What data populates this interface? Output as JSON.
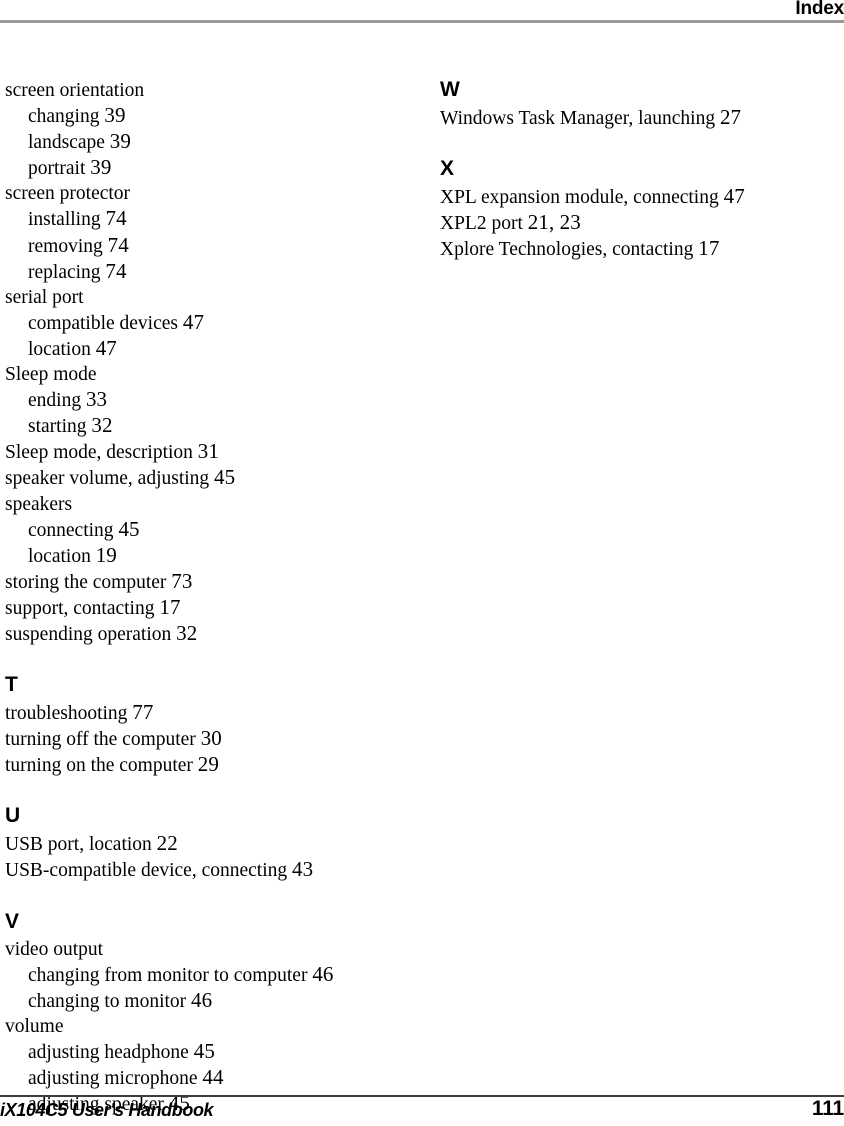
{
  "header": {
    "title": "Index",
    "rule_color": "#9a9a9a"
  },
  "footer": {
    "document_title": "iX104C5 User's Handbook",
    "page_number": "111",
    "rule_color": "#3c3c3c"
  },
  "columns": {
    "left": [
      {
        "letter": null,
        "entries": [
          {
            "text": "screen orientation",
            "page": "",
            "level": 0
          },
          {
            "text": "changing",
            "page": "39",
            "level": 1
          },
          {
            "text": "landscape",
            "page": "39",
            "level": 1
          },
          {
            "text": "portrait",
            "page": "39",
            "level": 1
          },
          {
            "text": "screen protector",
            "page": "",
            "level": 0
          },
          {
            "text": "installing",
            "page": "74",
            "level": 1
          },
          {
            "text": "removing",
            "page": "74",
            "level": 1
          },
          {
            "text": "replacing",
            "page": "74",
            "level": 1
          },
          {
            "text": "serial port",
            "page": "",
            "level": 0
          },
          {
            "text": "compatible devices",
            "page": "47",
            "level": 1
          },
          {
            "text": "location",
            "page": "47",
            "level": 1
          },
          {
            "text": "Sleep mode",
            "page": "",
            "level": 0
          },
          {
            "text": "ending",
            "page": "33",
            "level": 1
          },
          {
            "text": "starting",
            "page": "32",
            "level": 1
          },
          {
            "text": "Sleep mode, description",
            "page": "31",
            "level": 0
          },
          {
            "text": "speaker volume, adjusting",
            "page": "45",
            "level": 0
          },
          {
            "text": "speakers",
            "page": "",
            "level": 0
          },
          {
            "text": "connecting",
            "page": "45",
            "level": 1
          },
          {
            "text": "location",
            "page": "19",
            "level": 1
          },
          {
            "text": "storing the computer",
            "page": "73",
            "level": 0
          },
          {
            "text": "support, contacting",
            "page": "17",
            "level": 0
          },
          {
            "text": "suspending operation",
            "page": "32",
            "level": 0
          }
        ]
      },
      {
        "letter": "T",
        "entries": [
          {
            "text": "troubleshooting",
            "page": "77",
            "level": 0
          },
          {
            "text": "turning off the computer",
            "page": "30",
            "level": 0
          },
          {
            "text": "turning on the computer",
            "page": "29",
            "level": 0
          }
        ]
      },
      {
        "letter": "U",
        "entries": [
          {
            "text": "USB port, location",
            "page": "22",
            "level": 0
          },
          {
            "text": "USB-compatible device, connecting",
            "page": "43",
            "level": 0
          }
        ]
      },
      {
        "letter": "V",
        "entries": [
          {
            "text": "video output",
            "page": "",
            "level": 0
          },
          {
            "text": "changing from monitor to computer",
            "page": "46",
            "level": 1
          },
          {
            "text": "changing to monitor",
            "page": "46",
            "level": 1
          },
          {
            "text": "volume",
            "page": "",
            "level": 0
          },
          {
            "text": "adjusting headphone",
            "page": "45",
            "level": 1
          },
          {
            "text": "adjusting microphone",
            "page": "44",
            "level": 1
          },
          {
            "text": "adjusting speaker",
            "page": "45",
            "level": 1
          }
        ]
      }
    ],
    "right": [
      {
        "letter": "W",
        "entries": [
          {
            "text": "Windows Task Manager, launching",
            "page": "27",
            "level": 0
          }
        ]
      },
      {
        "letter": "X",
        "entries": [
          {
            "text": "XPL expansion module, connecting",
            "page": "47",
            "level": 0
          },
          {
            "text": "XPL2 port",
            "page": "21, 23",
            "level": 0
          },
          {
            "text": "Xplore Technologies, contacting",
            "page": "17",
            "level": 0
          }
        ]
      }
    ]
  }
}
